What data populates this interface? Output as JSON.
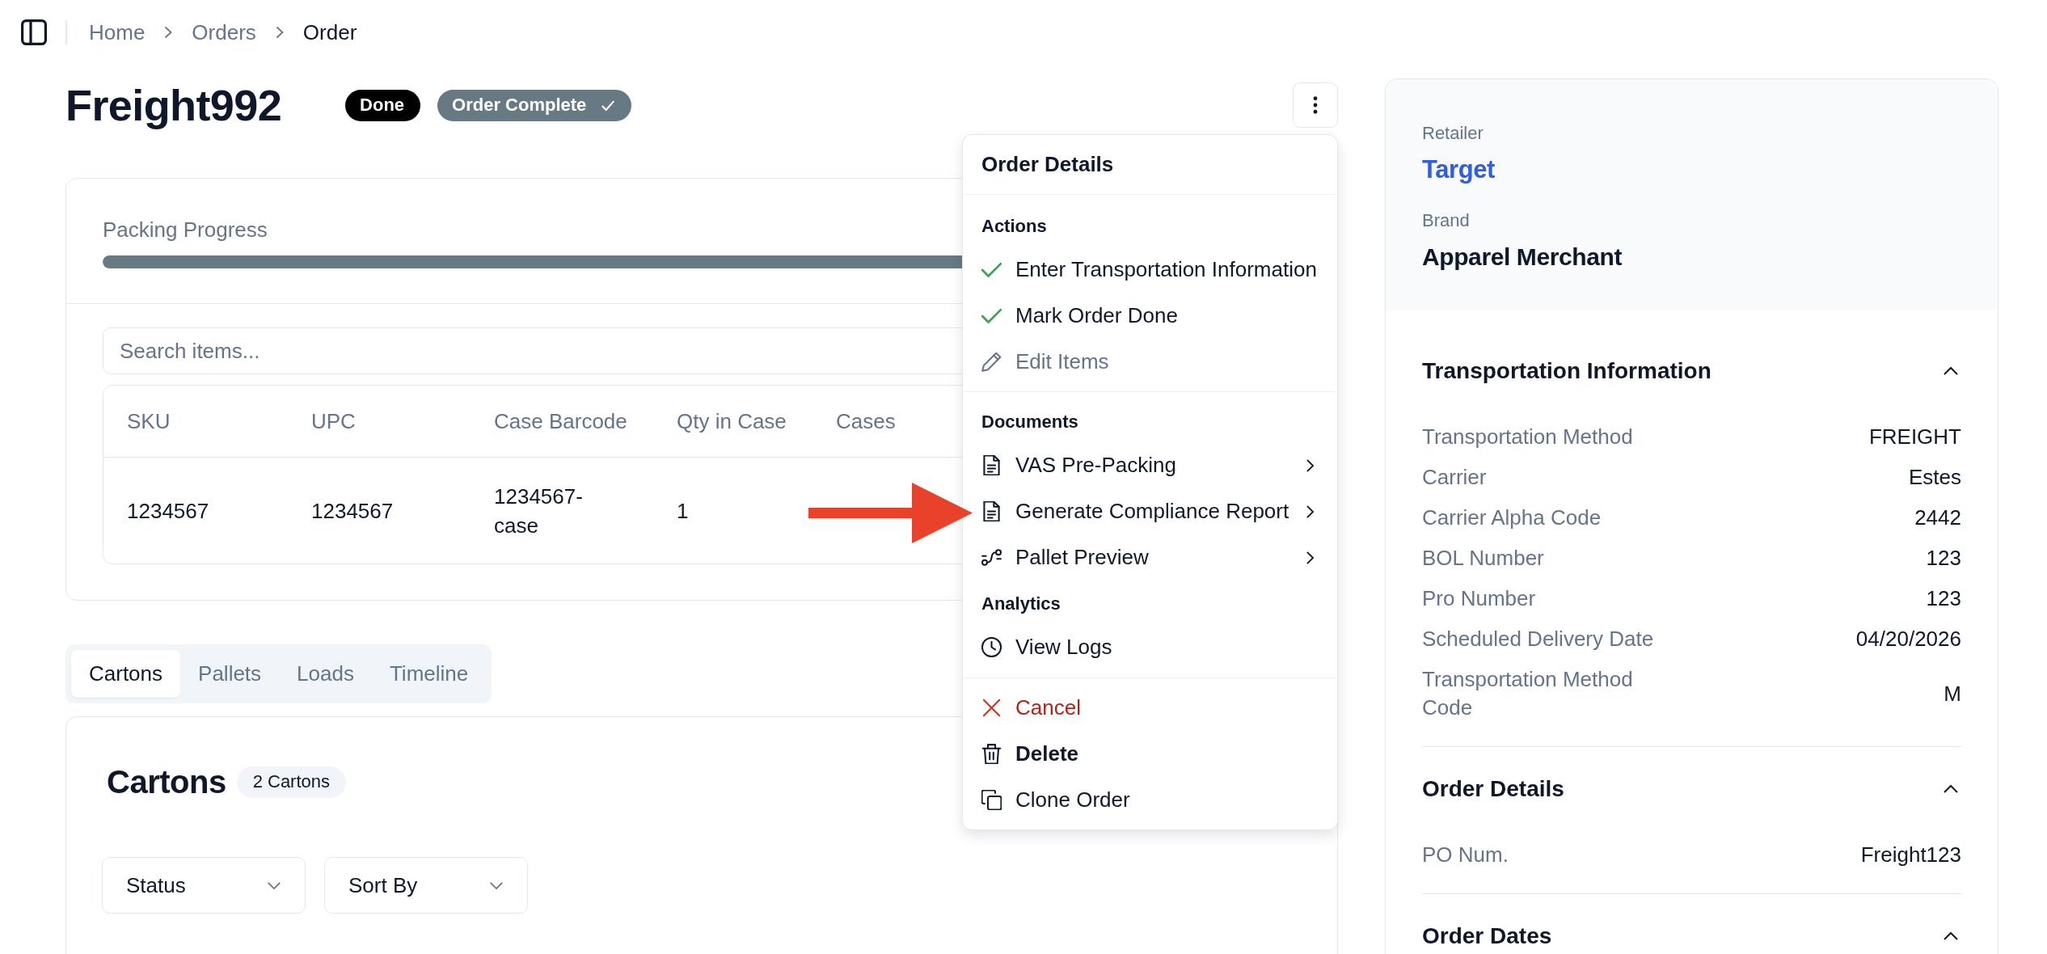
{
  "topbar": {
    "breadcrumb": [
      {
        "label": "Home",
        "current": false
      },
      {
        "label": "Orders",
        "current": false
      },
      {
        "label": "Order",
        "current": true
      }
    ]
  },
  "header": {
    "title": "Freight992",
    "badges": [
      {
        "label": "Done",
        "color": "#000000",
        "checked": false
      },
      {
        "label": "Order Complete",
        "color": "#677983",
        "checked": true
      }
    ]
  },
  "packing": {
    "progress": {
      "label": "Packing Progress",
      "level": 1
    },
    "search": {
      "placeholder": "Search items..."
    },
    "table": {
      "columns": [
        "SKU",
        "UPC",
        "Case Barcode",
        "Qty in Case",
        "Cases"
      ],
      "rows": [
        {
          "cells": [
            "1234567",
            "1234567",
            "1234567-case",
            "1"
          ]
        }
      ]
    }
  },
  "tabs": [
    {
      "label": "Cartons",
      "selected": true
    },
    {
      "label": "Pallets",
      "selected": false
    },
    {
      "label": "Loads",
      "selected": false
    },
    {
      "label": "Timeline",
      "selected": false
    }
  ],
  "cartons": {
    "title": "Cartons",
    "count": "2 Cartons",
    "filters": [
      {
        "label": "Status"
      },
      {
        "label": "Sort By"
      }
    ]
  },
  "menu": {
    "title": "Order Details",
    "groups": [
      {
        "sections": [
          {
            "heading": "Actions",
            "items": [
              {
                "label": "Enter Transportation Information",
                "kind": "completed",
                "disabled": false
              },
              {
                "label": "Mark Order Done",
                "kind": "completed",
                "disabled": false
              },
              {
                "label": "Edit Items",
                "kind": "edit",
                "disabled": true
              }
            ]
          }
        ]
      },
      {
        "sections": [
          {
            "heading": "Documents",
            "items": [
              {
                "label": "VAS Pre-Packing",
                "kind": "document",
                "disabled": false
              },
              {
                "label": "Generate Compliance Report",
                "kind": "document",
                "disabled": false
              },
              {
                "label": "Pallet Preview",
                "kind": "preview",
                "disabled": false
              }
            ]
          },
          {
            "heading": "Analytics",
            "items": [
              {
                "label": "View Logs",
                "kind": "logs",
                "disabled": false
              }
            ]
          }
        ]
      },
      {
        "sections": [
          {
            "items": [
              {
                "label": "Cancel",
                "kind": "cancel",
                "disabled": false
              },
              {
                "label": "Delete",
                "kind": "delete",
                "disabled": false
              },
              {
                "label": "Clone Order",
                "kind": "clone",
                "disabled": false
              }
            ]
          }
        ]
      }
    ]
  },
  "summary": {
    "retailer": {
      "label": "Retailer",
      "value": "Target"
    },
    "brand": {
      "label": "Brand",
      "value": "Apparel Merchant"
    },
    "sections": [
      {
        "title": "Transportation Information",
        "expanded": true,
        "rows": [
          {
            "label": "Transportation Method",
            "value": "FREIGHT"
          },
          {
            "label": "Carrier",
            "value": "Estes"
          },
          {
            "label": "Carrier Alpha Code",
            "value": "2442"
          },
          {
            "label": "BOL Number",
            "value": "123"
          },
          {
            "label": "Pro Number",
            "value": "123"
          },
          {
            "label": "Scheduled Delivery Date",
            "value": "04/20/2026"
          },
          {
            "label": "Transportation Method Code",
            "value": "M"
          }
        ]
      },
      {
        "title": "Order Details",
        "expanded": true,
        "rows": [
          {
            "label": "PO Num.",
            "value": "Freight123"
          }
        ]
      },
      {
        "title": "Order Dates",
        "expanded": true
      }
    ]
  }
}
